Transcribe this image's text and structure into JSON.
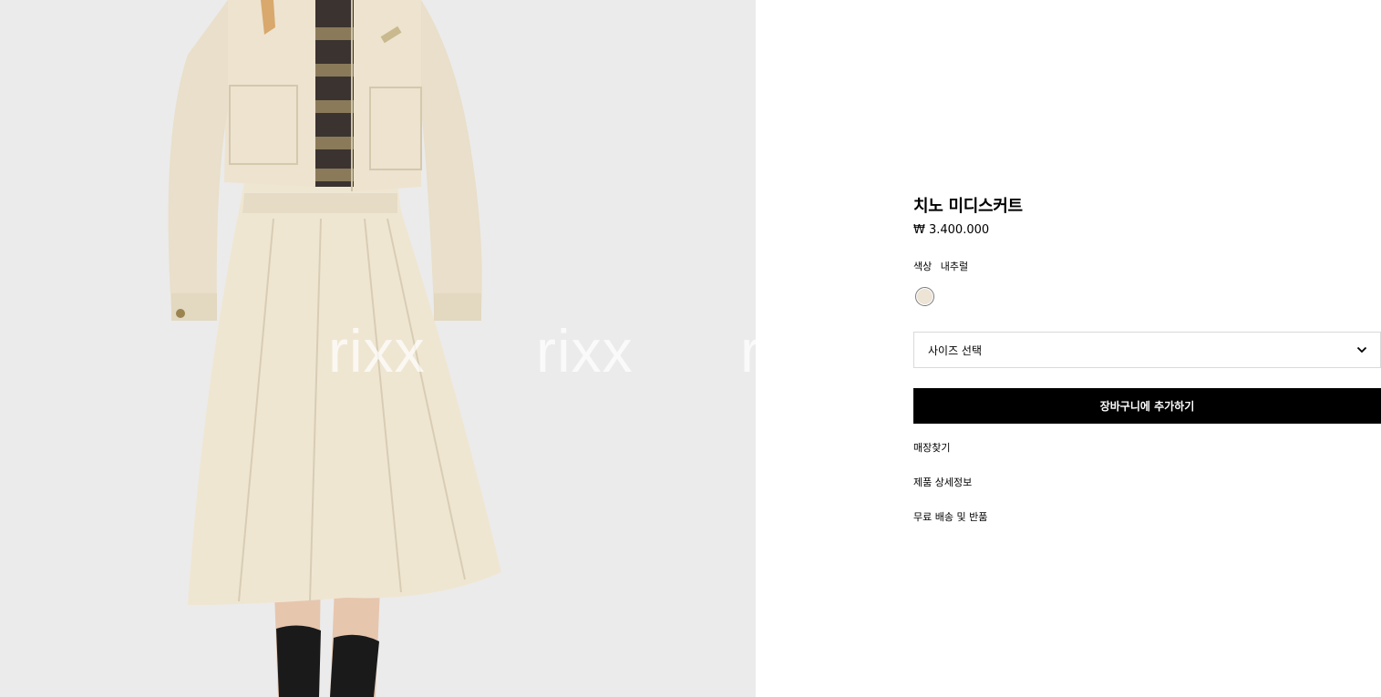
{
  "product": {
    "title": "치노 미디스커트",
    "price": "₩ 3.400.000"
  },
  "color": {
    "label": "색상",
    "value": "내추럴",
    "swatch_hex": "#ede4d6"
  },
  "size_select": {
    "label": "사이즈 선택",
    "icon": "chevron-down-icon"
  },
  "cart_button": {
    "label": "장바구니에 추가하기",
    "background": "#000000"
  },
  "links": {
    "store_finder": "매장찾기",
    "product_details": "제품 상세정보",
    "shipping_returns": "무료 배송 및 반품"
  },
  "watermark_text": "rixx",
  "colors": {
    "image_background": "#ebebeb",
    "garment": "#efe6d2",
    "socks": "#1a1a1a"
  }
}
